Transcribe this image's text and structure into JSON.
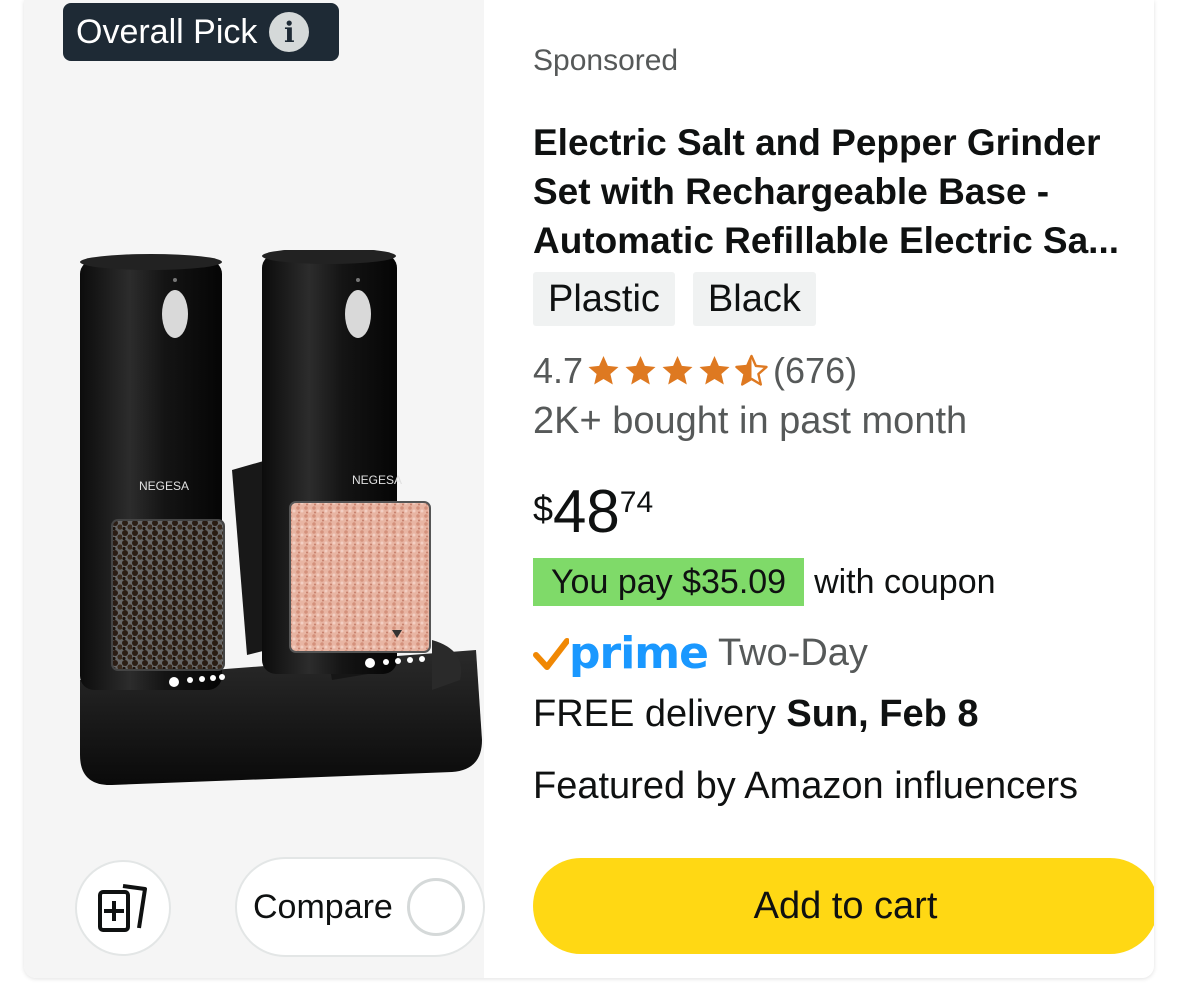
{
  "badge": {
    "label": "Overall Pick",
    "icon": "info-icon"
  },
  "sponsored_label": "Sponsored",
  "product": {
    "title": "Electric Salt and Pepper Grinder Set with Rechargeable Base - Automatic Refillable Electric Sa...",
    "image_brand_text": "NEGESA",
    "variants": [
      "Plastic",
      "Black"
    ],
    "rating": "4.7",
    "rating_value": 4.7,
    "review_count": "(676)",
    "bought_text": "2K+ bought in past month",
    "price": {
      "symbol": "$",
      "whole": "48",
      "fraction": "74"
    },
    "coupon": {
      "text": "You pay $35.09",
      "suffix": "with coupon"
    },
    "prime": {
      "word": "prime",
      "speed": "Two-Day"
    },
    "delivery": {
      "prefix": "FREE delivery ",
      "date": "Sun, Feb 8"
    },
    "featured": "Featured by Amazon influencers"
  },
  "actions": {
    "compare_label": "Compare",
    "add_to_cart_label": "Add to cart",
    "add_to_list_icon": "add-to-list-icon"
  },
  "colors": {
    "badge_bg": "#1e2a35",
    "star": "#de7921",
    "coupon_bg": "#7fda69",
    "prime_blue": "#1a98ff",
    "prime_check": "#f08804",
    "cart_button": "#ffd814"
  }
}
